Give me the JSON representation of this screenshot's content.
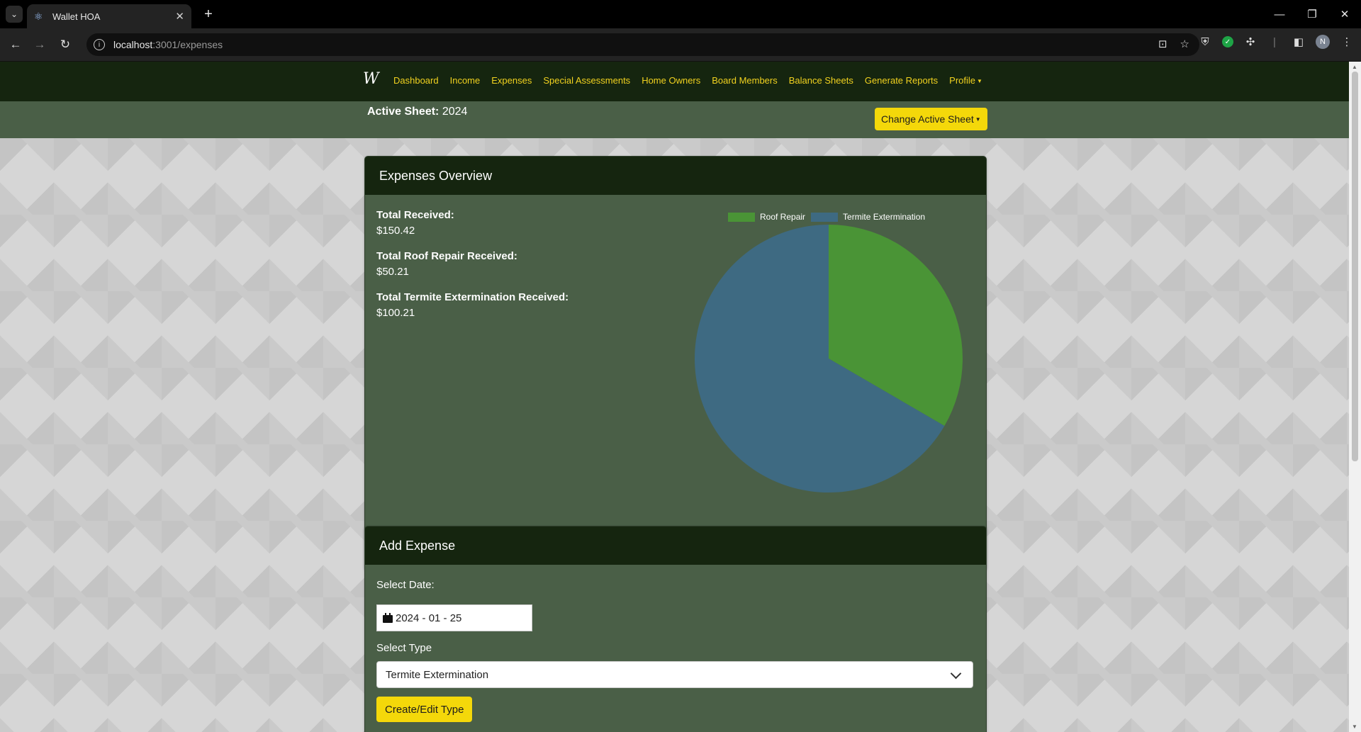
{
  "browser": {
    "tab_title": "Wallet HOA",
    "url_host": "localhost",
    "url_rest": ":3001/expenses",
    "profile_initial": "N"
  },
  "nav": {
    "brand": "W",
    "links": [
      "Dashboard",
      "Income",
      "Expenses",
      "Special Assessments",
      "Home Owners",
      "Board Members",
      "Balance Sheets",
      "Generate Reports",
      "Profile"
    ]
  },
  "sheet": {
    "label": "Active Sheet:",
    "value": "2024",
    "change_button": "Change Active Sheet"
  },
  "overview": {
    "title": "Expenses Overview",
    "stats": [
      {
        "label": "Total Received:",
        "value": "$150.42"
      },
      {
        "label": "Total Roof Repair Received:",
        "value": "$50.21"
      },
      {
        "label": "Total Termite Extermination Received:",
        "value": "$100.21"
      }
    ]
  },
  "chart_data": {
    "type": "pie",
    "categories": [
      "Roof Repair",
      "Termite Extermination"
    ],
    "values": [
      50.21,
      100.21
    ],
    "colors": [
      "#4a9436",
      "#3e6a82"
    ],
    "legend": "top"
  },
  "add_expense": {
    "title": "Add Expense",
    "date_label": "Select Date:",
    "date_value": "2024 - 01 - 25",
    "type_label": "Select Type",
    "type_value": "Termite Extermination",
    "create_type_button": "Create/Edit Type"
  }
}
